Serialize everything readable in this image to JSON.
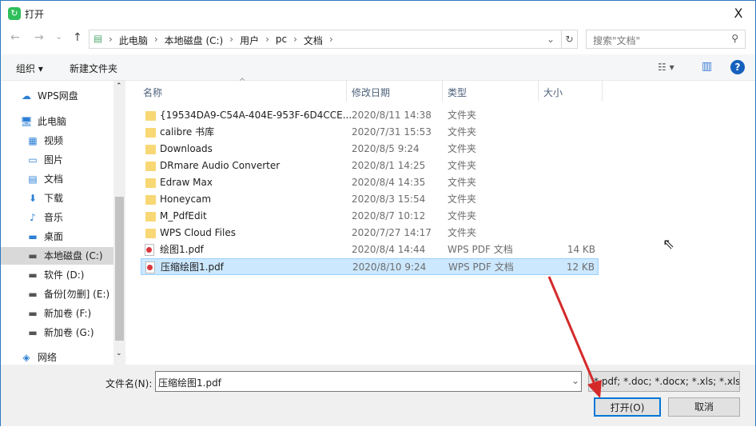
{
  "window": {
    "title": "打开",
    "close": "X"
  },
  "nav": {
    "back": "←",
    "forward": "→",
    "recent": "⌄",
    "up": "↑",
    "breadcrumb": [
      "此电脑",
      "本地磁盘 (C:)",
      "用户",
      "pc",
      "文档"
    ],
    "search_placeholder": "搜索\"文档\""
  },
  "toolbar": {
    "organize": "组织 ▾",
    "new_folder": "新建文件夹",
    "view": "☷ ▾",
    "preview": "▥",
    "help": "?"
  },
  "sidebar": [
    {
      "label": "WPS网盘",
      "icon": "cloud-icon"
    },
    {
      "label": "此电脑",
      "icon": "computer-icon"
    },
    {
      "label": "视频",
      "icon": "video-icon"
    },
    {
      "label": "图片",
      "icon": "picture-icon"
    },
    {
      "label": "文档",
      "icon": "document-icon"
    },
    {
      "label": "下载",
      "icon": "download-icon"
    },
    {
      "label": "音乐",
      "icon": "music-icon"
    },
    {
      "label": "桌面",
      "icon": "desktop-icon"
    },
    {
      "label": "本地磁盘 (C:)",
      "icon": "drive-icon"
    },
    {
      "label": "软件 (D:)",
      "icon": "drive-icon"
    },
    {
      "label": "备份[勿删] (E:)",
      "icon": "drive-icon"
    },
    {
      "label": "新加卷 (F:)",
      "icon": "drive-icon"
    },
    {
      "label": "新加卷 (G:)",
      "icon": "drive-icon"
    },
    {
      "label": "网络",
      "icon": "network-icon"
    }
  ],
  "columns": {
    "name": "名称",
    "date": "修改日期",
    "type": "类型",
    "size": "大小"
  },
  "files": [
    {
      "name": "{19534DA9-C54A-404E-953F-6D4CCE...",
      "date": "2020/8/11 14:38",
      "type": "文件夹",
      "size": "",
      "kind": "folder"
    },
    {
      "name": "calibre 书库",
      "date": "2020/7/31 15:53",
      "type": "文件夹",
      "size": "",
      "kind": "folder"
    },
    {
      "name": "Downloads",
      "date": "2020/8/5 9:24",
      "type": "文件夹",
      "size": "",
      "kind": "folder"
    },
    {
      "name": "DRmare Audio Converter",
      "date": "2020/8/1 14:25",
      "type": "文件夹",
      "size": "",
      "kind": "folder"
    },
    {
      "name": "Edraw Max",
      "date": "2020/8/4 14:35",
      "type": "文件夹",
      "size": "",
      "kind": "folder"
    },
    {
      "name": "Honeycam",
      "date": "2020/8/3 15:54",
      "type": "文件夹",
      "size": "",
      "kind": "folder"
    },
    {
      "name": "M_PdfEdit",
      "date": "2020/8/7 10:12",
      "type": "文件夹",
      "size": "",
      "kind": "folder"
    },
    {
      "name": "WPS Cloud Files",
      "date": "2020/7/27 14:17",
      "type": "文件夹",
      "size": "",
      "kind": "folder"
    },
    {
      "name": "绘图1.pdf",
      "date": "2020/8/4 14:44",
      "type": "WPS PDF 文档",
      "size": "14 KB",
      "kind": "pdf"
    },
    {
      "name": "压缩绘图1.pdf",
      "date": "2020/8/10 9:24",
      "type": "WPS PDF 文档",
      "size": "12 KB",
      "kind": "pdf",
      "selected": true
    }
  ],
  "footer": {
    "filename_label": "文件名(N):",
    "filename_value": "压缩绘图1.pdf",
    "filter": "*.pdf; *.doc; *.docx; *.xls; *.xls",
    "open": "打开(O)",
    "cancel": "取消"
  },
  "colors": {
    "accent": "#0078d7",
    "selection": "#cce8ff",
    "arrow": "#d42a2a"
  }
}
